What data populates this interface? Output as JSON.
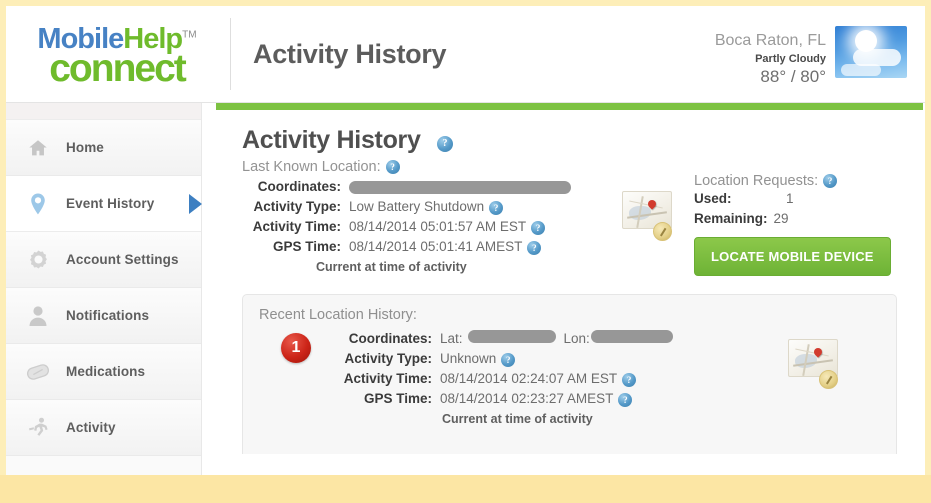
{
  "brand": {
    "logo_line1_part1": "Mobile",
    "logo_line1_part2": "Help",
    "logo_tm": "TM",
    "logo_line2": "connect"
  },
  "header": {
    "title": "Activity History"
  },
  "weather": {
    "city": "Boca Raton, FL",
    "condition": "Partly Cloudy",
    "temperature": "88° / 80°",
    "icon": "partly-cloudy-icon"
  },
  "sidebar": {
    "items": [
      {
        "label": "Home",
        "icon": "home-icon",
        "active": false
      },
      {
        "label": "Event History",
        "icon": "map-pin-icon",
        "active": true
      },
      {
        "label": "Account Settings",
        "icon": "gear-icon",
        "active": false
      },
      {
        "label": "Notifications",
        "icon": "person-icon",
        "active": false
      },
      {
        "label": "Medications",
        "icon": "pill-icon",
        "active": false
      },
      {
        "label": "Activity",
        "icon": "runner-icon",
        "active": false
      }
    ]
  },
  "main": {
    "title": "Activity History",
    "help_glyph": "?",
    "last_known_location_label": "Last Known Location:",
    "fields": {
      "coordinates_label": "Coordinates:",
      "coordinates_value": "",
      "activity_type_label": "Activity Type:",
      "activity_type_value": "Low Battery Shutdown",
      "activity_time_label": "Activity Time:",
      "activity_time_value": "08/14/2014 05:01:57 AM EST",
      "gps_time_label": "GPS Time:",
      "gps_time_value": "08/14/2014 05:01:41 AMEST",
      "note": "Current at time of activity"
    },
    "map_thumbnail_icon": "map-thumbnail-icon"
  },
  "location_requests": {
    "title": "Location Requests:",
    "used_label": "Used:",
    "used_value": "1",
    "remaining_label": "Remaining:",
    "remaining_value": "29",
    "locate_button": "LOCATE MOBILE DEVICE",
    "map_thumbnail_icon": "map-thumbnail-icon"
  },
  "recent_location_history": {
    "title": "Recent Location History:",
    "entries": [
      {
        "badge": "1",
        "coordinates_label": "Coordinates:",
        "lat_label": "Lat:",
        "lat_value": "",
        "lon_label": "Lon:",
        "lon_value": "",
        "activity_type_label": "Activity Type:",
        "activity_type_value": "Unknown",
        "activity_time_label": "Activity Time:",
        "activity_time_value": "08/14/2014 02:24:07 AM EST",
        "gps_time_label": "GPS Time:",
        "gps_time_value": "08/14/2014 02:23:27 AMEST",
        "note": "Current at time of activity",
        "map_thumbnail_icon": "map-thumbnail-icon"
      }
    ]
  },
  "colors": {
    "brand_blue": "#4782c4",
    "brand_green": "#6fbb2c",
    "accent_green_bar": "#7dc242",
    "button_green": "#7dc242",
    "active_arrow_blue": "#3d7fc1",
    "badge_red": "#cc2418",
    "page_border_cream": "#fdeeb8"
  }
}
